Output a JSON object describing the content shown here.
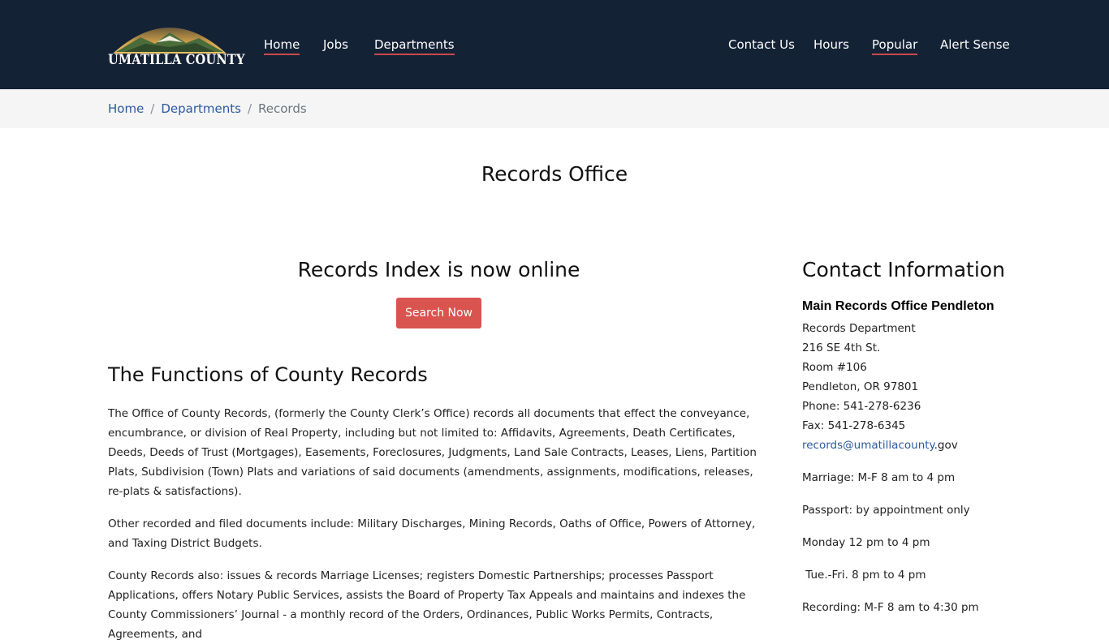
{
  "header": {
    "logo_text": "UMATILLA COUNTY",
    "nav_left": [
      "Home",
      "Jobs",
      "Departments"
    ],
    "nav_right": [
      "Contact Us",
      "Hours",
      "Popular",
      "Alert Sense"
    ]
  },
  "breadcrumb": [
    "Home",
    "Departments",
    "Records"
  ],
  "page_title": "Records Office",
  "main": {
    "index_title": "Records Index is now online",
    "search_button": "Search Now",
    "functions_title": "The Functions of County Records",
    "p1": "The Office of County Records, (formerly the County Clerk’s Office) records all documents that effect the conveyance, encumbrance, or division of Real Property, including but not limited to: Affidavits, Agreements, Death Certificates, Deeds, Deeds of Trust (Mortgages), Easements, Foreclosures, Judgments, Land Sale Contracts, Leases, Liens, Partition Plats, Subdivision (Town) Plats and variations of said documents (amendments, assignments, modifications, releases, re-plats & satisfactions).",
    "p2": "Other recorded and filed documents include: Military Discharges, Mining Records, Oaths of Office, Powers of Attorney, and Taxing District Budgets.",
    "p3": "County Records also: issues & records Marriage Licenses; registers Domestic Partnerships; processes Passport Applications, offers Notary Public Services, assists the Board of Property Tax Appeals and maintains and indexes the County Commissioners’ Journal - a monthly record of the Orders, Ordinances, Public Works Permits, Contracts, Agreements, and"
  },
  "contact": {
    "title": "Contact Information",
    "office": "Main Records Office Pendleton",
    "lines": [
      "Records Department",
      "216 SE 4th St.",
      "Room #106",
      "Pendleton, OR 97801",
      "Phone: 541-278-6236",
      "Fax: 541-278-6345"
    ],
    "email_link": "records@umatillacounty",
    "email_tail": ".gov",
    "hours": [
      "Marriage:  M-F 8 am to 4 pm",
      "Passport:  by appointment only",
      "Monday 12 pm to 4 pm",
      " Tue.-Fri. 8 pm to 4 pm",
      "Recording:  M-F 8 am to 4:30 pm"
    ]
  }
}
